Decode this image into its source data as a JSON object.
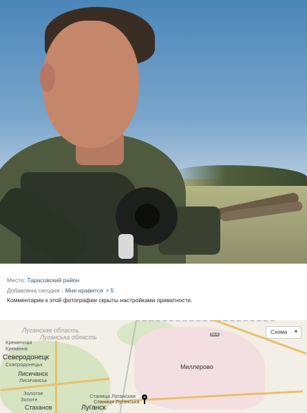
{
  "info": {
    "place_label": "Место:",
    "place_value": "Тарасовский район",
    "added_label": "Добавлена сегодня",
    "like_label": "Мне нравится",
    "like_count": "5",
    "privacy_note": "Комментарии к этой фотографии скрыты настройками приватности."
  },
  "map": {
    "map_type_select": "Схема",
    "labels": {
      "lugansk_oblast_1": "Луганская область",
      "lugansk_oblast_2": "Луганська область",
      "kremennaya_1": "Кременная",
      "kremennaya_2": "Кремінна",
      "severodonetsk_1": "Северодонецк",
      "severodonetsk_2": "Сєвєродонецьк",
      "lisichansk_1": "Лисичанск",
      "lisichansk_2": "Лисичанськ",
      "zolotoe_1": "Золотое",
      "zolotoe_2": "Золоте",
      "stakhanov": "Стаханов",
      "stanitsa_1": "Станица Луганская",
      "stanitsa_2": "Станиця Луганська",
      "lugansk": "Луганск",
      "millerovo": "Миллерово",
      "road_m4": "M-4"
    }
  },
  "colors": {
    "link": "#2b587a",
    "muted": "#777777"
  }
}
